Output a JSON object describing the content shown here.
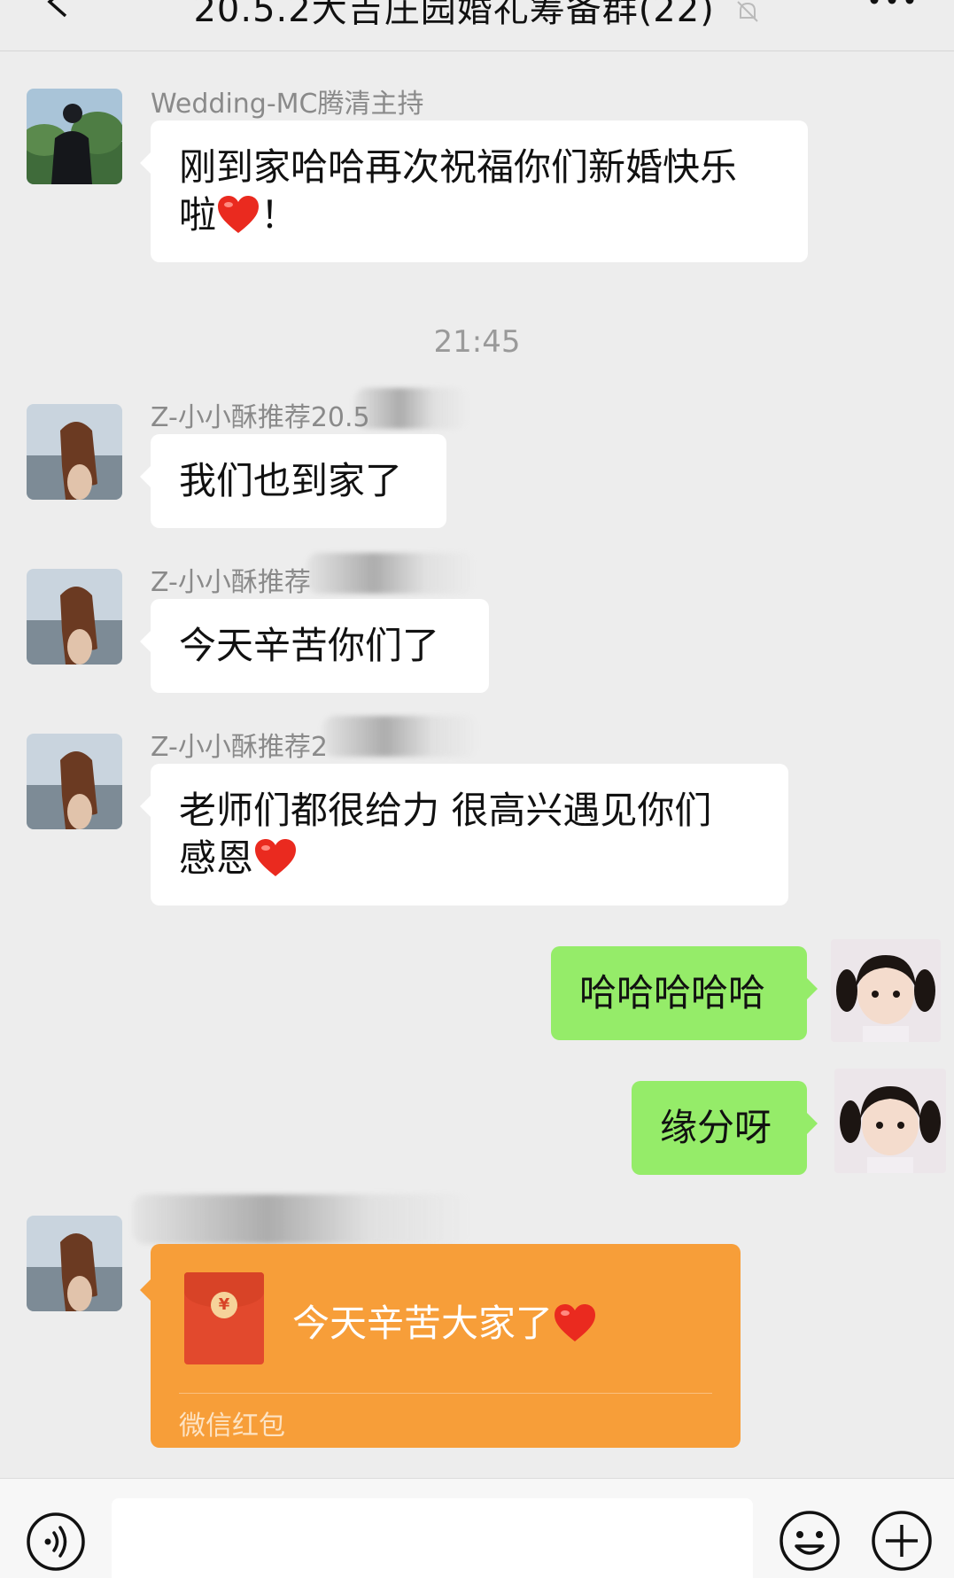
{
  "header": {
    "title": "20.5.2大吉庄园婚礼筹备群(22)"
  },
  "timestamp": "21:45",
  "messages": [
    {
      "sender": "Wedding-MC腾清主持",
      "line1": "刚到家哈哈再次祝福你们新婚快乐",
      "line2": "啦",
      "line2_suffix": "！"
    },
    {
      "sender": "Z-小小酥推荐20.5",
      "text": "我们也到家了"
    },
    {
      "sender": "Z-小小酥推荐",
      "text": "今天辛苦你们了"
    },
    {
      "sender": "Z-小小酥推荐2",
      "line1": "老师们都很给力 很高兴遇见你们",
      "line2": "感恩"
    },
    {
      "text": "哈哈哈哈哈"
    },
    {
      "text": "缘分呀"
    }
  ],
  "red_packet": {
    "greeting": "今天辛苦大家了",
    "label": "微信红包",
    "coin": "¥",
    "color": "#f79e39"
  },
  "colors": {
    "background": "#ededed",
    "outgoing_bubble": "#95ec69",
    "incoming_bubble": "#ffffff"
  }
}
